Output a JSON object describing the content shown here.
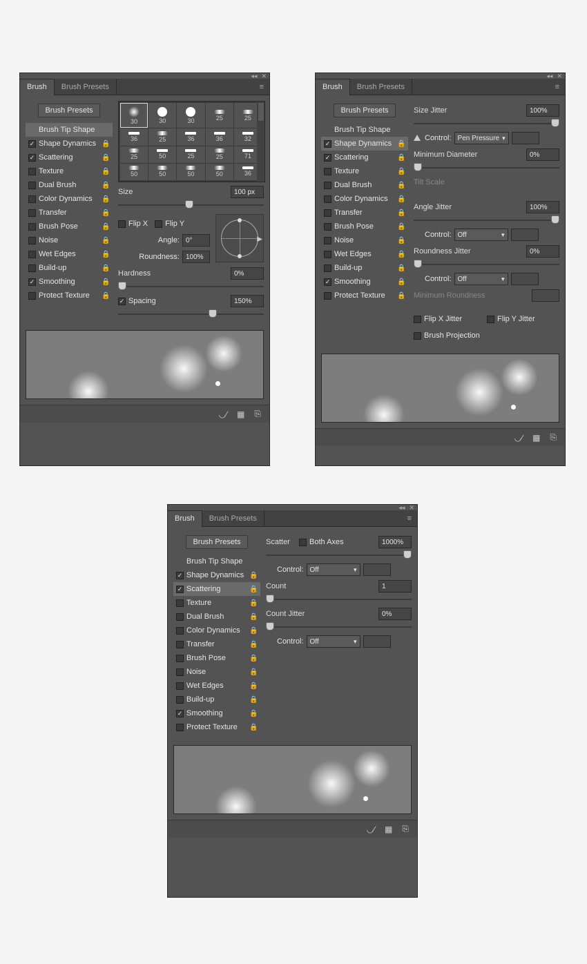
{
  "tabs": {
    "brush": "Brush",
    "presets": "Brush Presets"
  },
  "buttons": {
    "brush_presets": "Brush Presets",
    "brush_tip_shape": "Brush Tip Shape"
  },
  "options": [
    {
      "label": "Shape Dynamics",
      "checked": true
    },
    {
      "label": "Scattering",
      "checked": true
    },
    {
      "label": "Texture",
      "checked": false
    },
    {
      "label": "Dual Brush",
      "checked": false
    },
    {
      "label": "Color Dynamics",
      "checked": false
    },
    {
      "label": "Transfer",
      "checked": false
    },
    {
      "label": "Brush Pose",
      "checked": false
    },
    {
      "label": "Noise",
      "checked": false
    },
    {
      "label": "Wet Edges",
      "checked": false
    },
    {
      "label": "Build-up",
      "checked": false
    },
    {
      "label": "Smoothing",
      "checked": true
    },
    {
      "label": "Protect Texture",
      "checked": false
    }
  ],
  "brush_tip_sizes": [
    [
      30,
      30,
      30,
      25,
      25
    ],
    [
      36,
      25,
      36,
      36,
      32
    ],
    [
      25,
      50,
      25,
      25,
      71
    ],
    [
      50,
      50,
      50,
      50,
      36
    ]
  ],
  "tip_shape": {
    "size_label": "Size",
    "size_value": "100 px",
    "flipx": "Flip X",
    "flipy": "Flip Y",
    "angle_label": "Angle:",
    "angle_value": "0°",
    "roundness_label": "Roundness:",
    "roundness_value": "100%",
    "hardness_label": "Hardness",
    "hardness_value": "0%",
    "spacing_label": "Spacing",
    "spacing_value": "150%"
  },
  "shape_dynamics": {
    "size_jitter_label": "Size Jitter",
    "size_jitter_value": "100%",
    "control_label": "Control:",
    "control_pen": "Pen Pressure",
    "min_diameter_label": "Minimum Diameter",
    "min_diameter_value": "0%",
    "tilt_scale_label": "Tilt Scale",
    "angle_jitter_label": "Angle Jitter",
    "angle_jitter_value": "100%",
    "control_off": "Off",
    "roundness_jitter_label": "Roundness Jitter",
    "roundness_jitter_value": "0%",
    "min_roundness_label": "Minimum Roundness",
    "flip_x_jitter": "Flip X Jitter",
    "flip_y_jitter": "Flip Y Jitter",
    "brush_projection": "Brush Projection"
  },
  "scattering": {
    "scatter_label": "Scatter",
    "both_axes": "Both Axes",
    "scatter_value": "1000%",
    "control_label": "Control:",
    "control_off": "Off",
    "count_label": "Count",
    "count_value": "1",
    "count_jitter_label": "Count Jitter",
    "count_jitter_value": "0%"
  }
}
